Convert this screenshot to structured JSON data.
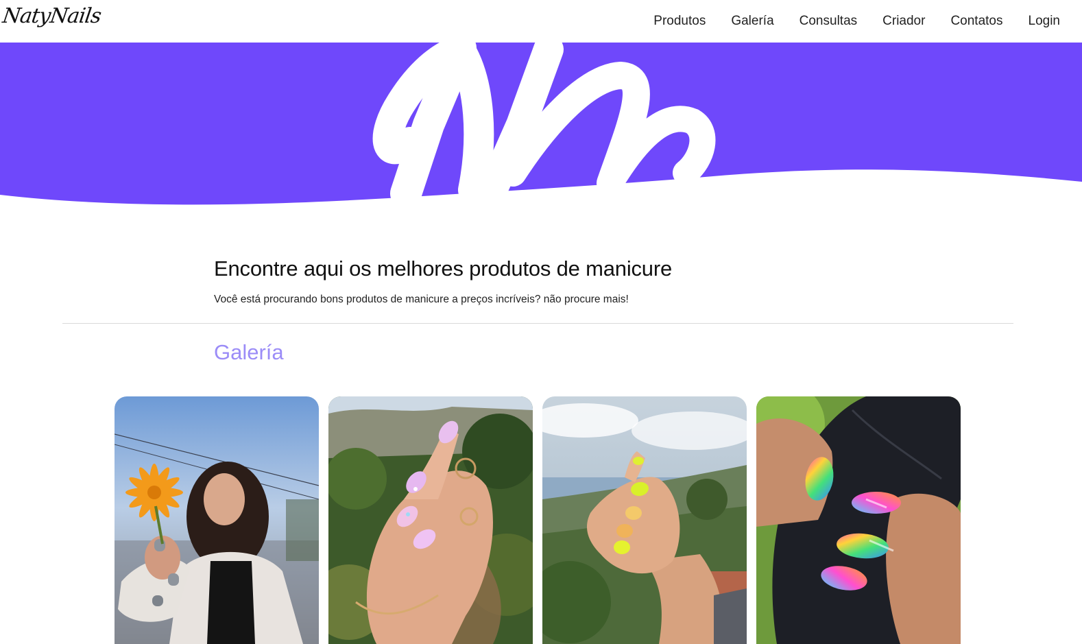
{
  "brand": {
    "name": "NatyNails"
  },
  "nav": {
    "items": [
      {
        "label": "Produtos"
      },
      {
        "label": "Galería"
      },
      {
        "label": "Consultas"
      },
      {
        "label": "Criador"
      },
      {
        "label": "Contatos"
      },
      {
        "label": "Login"
      }
    ]
  },
  "hero": {
    "background_color": "#6f48fb",
    "logo_color": "#ffffff"
  },
  "intro": {
    "title": "Encontre aqui os melhores produtos de manicure",
    "subtitle": "Você está procurando bons produtos de manicure a preços incríveis? não procure mais!"
  },
  "gallery": {
    "title": "Galería",
    "title_color": "#9b8cf7",
    "photos": [
      {
        "subject": "woman-holding-orange-flower-silver-nails"
      },
      {
        "subject": "hand-pink-pastel-nails-with-rings"
      },
      {
        "subject": "hand-neon-yellow-nails-landscape"
      },
      {
        "subject": "hand-rainbow-nails-black-fabric"
      }
    ]
  }
}
